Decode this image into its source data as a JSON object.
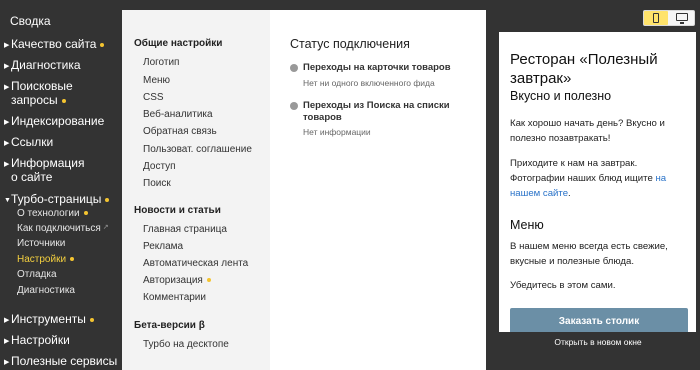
{
  "sidebar": {
    "summary": "Сводка",
    "site_quality": "Качество сайта",
    "diagnostics": "Диагностика",
    "search_queries_1": "Поисковые",
    "search_queries_2": "запросы",
    "indexing": "Индексирование",
    "links": "Ссылки",
    "site_info_1": "Информация",
    "site_info_2": "о сайте",
    "turbo_pages": "Турбо-страницы",
    "turbo_sub": {
      "about": "О технологии",
      "how_to_connect": "Как подключиться",
      "sources": "Источники",
      "settings": "Настройки",
      "debug": "Отладка",
      "diagnostics": "Диагностика"
    },
    "tools": "Инструменты",
    "settings": "Настройки",
    "useful_services": "Полезные сервисы"
  },
  "menu": {
    "general_header": "Общие настройки",
    "general_items": [
      "Логотип",
      "Меню",
      "CSS",
      "Веб-аналитика",
      "Обратная связь",
      "Пользоват. соглашение",
      "Доступ",
      "Поиск"
    ],
    "news_header": "Новости и статьи",
    "news_items": [
      "Главная страница",
      "Реклама",
      "Автоматическая лента",
      "Авторизация",
      "Комментарии"
    ],
    "beta_header": "Бета-версии β",
    "beta_items": [
      "Турбо на десктопе"
    ]
  },
  "status": {
    "title": "Статус подключения",
    "item1_title": "Переходы на карточки товаров",
    "item1_sub": "Нет ни одного включенного фида",
    "item2_title": "Переходы из Поиска на списки товаров",
    "item2_sub": "Нет информации"
  },
  "preview": {
    "title": "Ресторан «Полезный завтрак»",
    "subtitle": "Вкусно и полезно",
    "p1": "Как хорошо начать день? Вкусно и полезно позавтракать!",
    "p2_text": "Приходите к нам на завтрак. Фотографии наших блюд ищите ",
    "p2_link": "на нашем сайте",
    "p2_end": ".",
    "menu_heading": "Меню",
    "p3": "В нашем меню всегда есть свежие, вкусные и полезные блюда.",
    "p4": "Убедитесь в этом сами.",
    "button": "Заказать столик"
  },
  "open_new_window": "Открыть в новом окне",
  "colors": {
    "sidebar_bg": "#333333",
    "accent_yellow": "#f4c430",
    "active_item": "#f4d03f",
    "link": "#2a73c9",
    "button_bg": "#6b8fa6"
  },
  "icons": {
    "mobile_toggle": "phone-icon",
    "desktop_toggle": "monitor-icon",
    "external_link": "external-link-icon",
    "status": "status-dot-icon"
  }
}
